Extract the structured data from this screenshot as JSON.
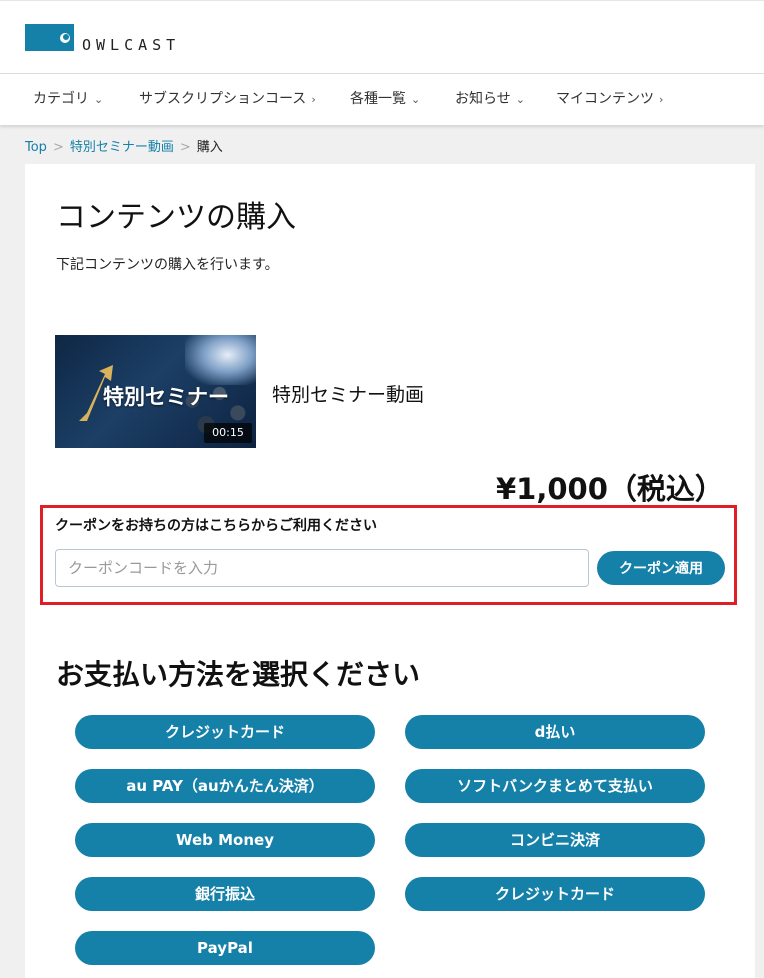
{
  "header": {
    "logo_text": "OWLCAST"
  },
  "nav": {
    "items": [
      {
        "label": "カテゴリ",
        "chevron": "⌄"
      },
      {
        "label": "サブスクリプションコース",
        "chevron": "›"
      },
      {
        "label": "各種一覧",
        "chevron": "⌄"
      },
      {
        "label": "お知らせ",
        "chevron": "⌄"
      },
      {
        "label": "マイコンテンツ",
        "chevron": "›"
      }
    ]
  },
  "breadcrumb": {
    "items": [
      "Top",
      "特別セミナー動画",
      "購入"
    ],
    "separator": ">"
  },
  "page": {
    "title": "コンテンツの購入",
    "description": "下記コンテンツの購入を行います。"
  },
  "content": {
    "thumbnail_text": "特別セミナー",
    "duration": "00:15",
    "title": "特別セミナー動画",
    "price": "¥1,000（税込）"
  },
  "coupon": {
    "label": "クーポンをお持ちの方はこちらからご利用ください",
    "placeholder": "クーポンコードを入力",
    "value": "",
    "button": "クーポン適用"
  },
  "payment": {
    "title": "お支払い方法を選択ください",
    "methods": [
      "クレジットカード",
      "d払い",
      "au PAY（auかんたん決済）",
      "ソフトバンクまとめて支払い",
      "Web Money",
      "コンビニ決済",
      "銀行振込",
      "クレジットカード",
      "PayPal"
    ]
  },
  "colors": {
    "accent": "#1580a8",
    "highlight_border": "#e01e25",
    "background": "#f0f0f0"
  }
}
